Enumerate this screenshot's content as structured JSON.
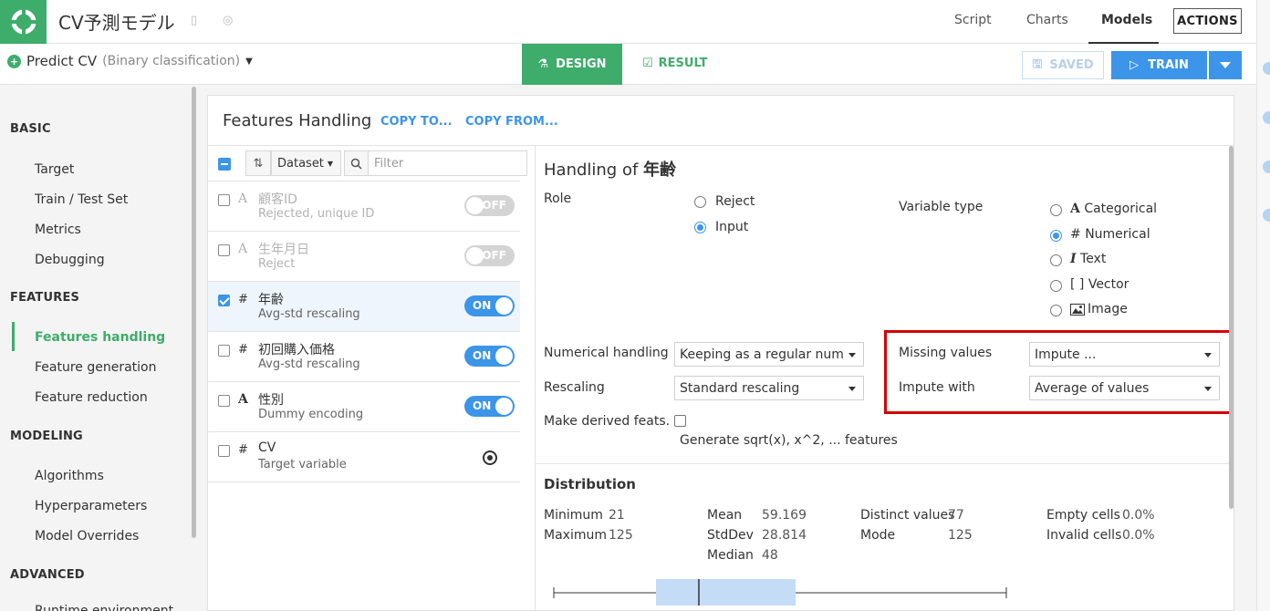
{
  "app": {
    "title": "CV予測モデル",
    "tabs": [
      "Script",
      "Charts",
      "Models"
    ],
    "active_tab": "Models",
    "actions_label": "ACTIONS"
  },
  "subbar": {
    "model_name": "Predict CV",
    "model_kind": "(Binary classification)",
    "design_label": "DESIGN",
    "result_label": "RESULT",
    "saved_label": "SAVED",
    "train_label": "TRAIN"
  },
  "nav": {
    "sections": [
      {
        "title": "BASIC",
        "items": [
          "Target",
          "Train / Test Set",
          "Metrics",
          "Debugging"
        ]
      },
      {
        "title": "FEATURES",
        "items": [
          "Features handling",
          "Feature generation",
          "Feature reduction"
        ]
      },
      {
        "title": "MODELING",
        "items": [
          "Algorithms",
          "Hyperparameters",
          "Model Overrides"
        ]
      },
      {
        "title": "ADVANCED",
        "items": [
          "Runtime environment"
        ]
      }
    ],
    "active_item": "Features handling"
  },
  "panel": {
    "title": "Features Handling",
    "copy_to": "COPY TO...",
    "copy_from": "COPY FROM...",
    "dataset_label": "Dataset",
    "filter_placeholder": "Filter"
  },
  "features": [
    {
      "type_icon": "A",
      "name": "顧客ID",
      "desc": "Rejected, unique ID",
      "toggle": "OFF",
      "checked": false,
      "dim": true
    },
    {
      "type_icon": "A",
      "name": "生年月日",
      "desc": "Reject",
      "toggle": "OFF",
      "checked": false,
      "dim": true
    },
    {
      "type_icon": "#",
      "name": "年齢",
      "desc": "Avg-std rescaling",
      "toggle": "ON",
      "checked": true,
      "dim": false
    },
    {
      "type_icon": "#",
      "name": "初回購入価格",
      "desc": "Avg-std rescaling",
      "toggle": "ON",
      "checked": false,
      "dim": false
    },
    {
      "type_icon": "A",
      "name": "性別",
      "desc": "Dummy encoding",
      "toggle": "ON",
      "checked": false,
      "dim": false
    },
    {
      "type_icon": "#",
      "name": "CV",
      "desc": "Target variable",
      "toggle": "target",
      "checked": false,
      "dim": false
    }
  ],
  "handling": {
    "title_prefix": "Handling of",
    "feature": "年齢",
    "role_label": "Role",
    "role_options": [
      "Reject",
      "Input"
    ],
    "role_selected": "Input",
    "vartype_label": "Variable type",
    "vartype_options": [
      {
        "icon": "A",
        "label": "Categorical"
      },
      {
        "icon": "#",
        "label": "Numerical"
      },
      {
        "icon": "I",
        "label": "Text"
      },
      {
        "icon": "[ ]",
        "label": "Vector"
      },
      {
        "icon": "image-icon",
        "label": "Image"
      }
    ],
    "vartype_selected": "Numerical",
    "numerical_handling_label": "Numerical handling",
    "numerical_handling_value": "Keeping as a regular numerical feature",
    "rescaling_label": "Rescaling",
    "rescaling_value": "Standard rescaling",
    "derived_label": "Make derived feats.",
    "derived_hint": "Generate sqrt(x), x^2, ... features",
    "missing_label": "Missing values",
    "missing_value": "Impute ...",
    "impute_label": "Impute with",
    "impute_value": "Average of values"
  },
  "distribution": {
    "title": "Distribution",
    "stats": [
      {
        "label": "Minimum",
        "value": "21"
      },
      {
        "label": "Maximum",
        "value": "125"
      },
      {
        "label": "Mean",
        "value": "59.169"
      },
      {
        "label": "StdDev",
        "value": "28.814"
      },
      {
        "label": "Median",
        "value": "48"
      },
      {
        "label": "Distinct values",
        "value": "77"
      },
      {
        "label": "Mode",
        "value": "125"
      },
      {
        "label": "Empty cells",
        "value": "0.0%"
      },
      {
        "label": "Invalid cells",
        "value": "0.0%"
      }
    ]
  },
  "colors": {
    "brand_green": "#3eac6b",
    "accent_blue": "#3c95e8",
    "highlight_red": "#d40000"
  }
}
